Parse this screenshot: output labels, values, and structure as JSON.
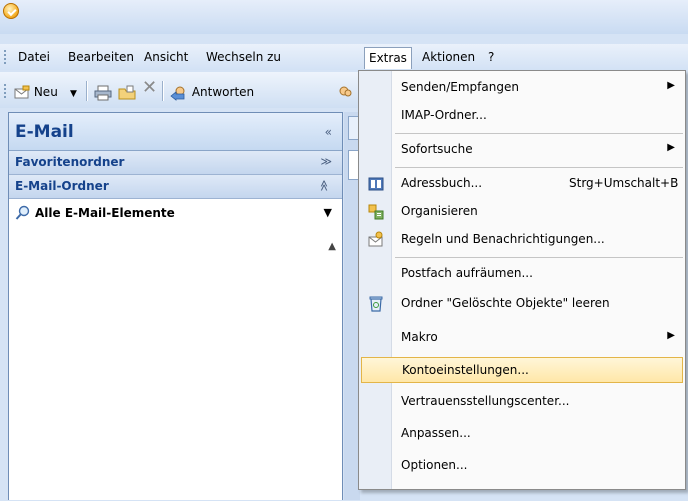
{
  "menubar": {
    "items": [
      "Datei",
      "Bearbeiten",
      "Ansicht",
      "Wechseln zu",
      "Extras",
      "Aktionen",
      "?"
    ],
    "active": "Extras"
  },
  "toolbar": {
    "new_label": "Neu",
    "reply_label": "Antworten"
  },
  "nav": {
    "title": "E-Mail",
    "collapse": "«",
    "favorites_label": "Favoritenordner",
    "mail_folders_label": "E-Mail-Ordner",
    "all_items_label": "Alle E-Mail-Elemente"
  },
  "extras_menu": {
    "items": [
      {
        "label": "Senden/Empfangen",
        "submenu": true
      },
      {
        "label": "IMAP-Ordner..."
      },
      {
        "label": "Sofortsuche",
        "submenu": true
      },
      {
        "label": "Adressbuch...",
        "shortcut": "Strg+Umschalt+B",
        "icon": "address-book-icon"
      },
      {
        "label": "Organisieren",
        "icon": "organize-icon"
      },
      {
        "label": "Regeln und Benachrichtigungen...",
        "icon": "rules-icon"
      },
      {
        "label": "Postfach aufräumen..."
      },
      {
        "label": "Ordner \"Gelöschte Objekte\" leeren",
        "icon": "empty-trash-icon"
      },
      {
        "label": "Makro",
        "submenu": true
      },
      {
        "label": "Kontoeinstellungen...",
        "highlighted": true
      },
      {
        "label": "Vertrauensstellungscenter..."
      },
      {
        "label": "Anpassen..."
      },
      {
        "label": "Optionen..."
      }
    ]
  },
  "colors": {
    "highlight": "#ffe7a8",
    "nav_title": "#15428b",
    "panel_border": "#6f8db6"
  }
}
